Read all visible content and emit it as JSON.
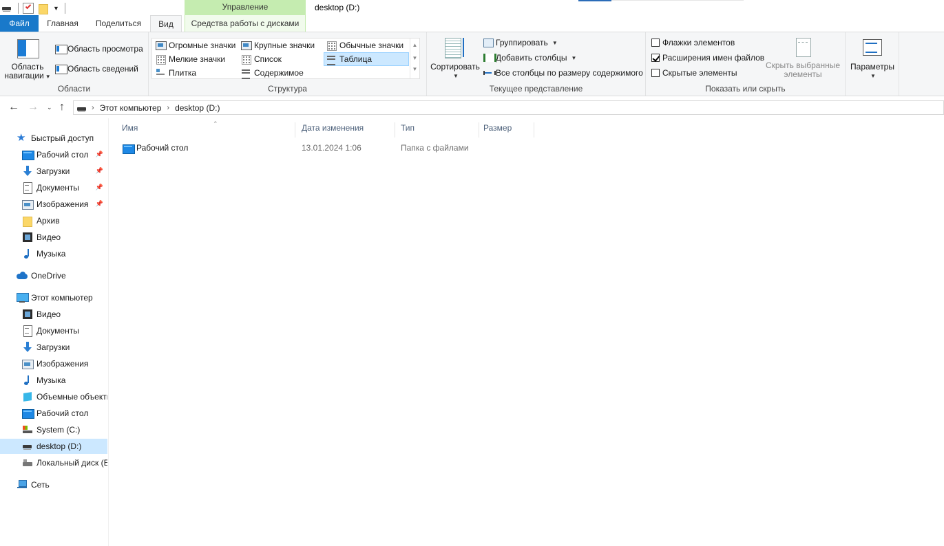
{
  "window": {
    "title": "desktop (D:)",
    "contextual_tab_header": "Управление"
  },
  "tabs": {
    "file": "Файл",
    "home": "Главная",
    "share": "Поделиться",
    "view": "Вид",
    "disk_tools": "Средства работы с дисками"
  },
  "ribbon": {
    "panes": {
      "label": "Области",
      "navigation_pane": "Область навигации",
      "preview_pane": "Область просмотра",
      "details_pane": "Область сведений"
    },
    "layout": {
      "label": "Структура",
      "options": [
        "Огромные значки",
        "Крупные значки",
        "Обычные значки",
        "Мелкие значки",
        "Список",
        "Таблица",
        "Плитка",
        "Содержимое"
      ],
      "selected": "Таблица"
    },
    "current_view": {
      "label": "Текущее представление",
      "sort_by": "Сортировать",
      "group_by": "Группировать",
      "add_columns": "Добавить столбцы",
      "fit_columns": "Все столбцы по размеру содержимого"
    },
    "show_hide": {
      "label": "Показать или скрыть",
      "item_checkboxes": {
        "label": "Флажки элементов",
        "checked": false
      },
      "file_extensions": {
        "label": "Расширения имен файлов",
        "checked": true
      },
      "hidden_items": {
        "label": "Скрытые элементы",
        "checked": false
      },
      "hide_selected": "Скрыть выбранные элементы"
    },
    "options": {
      "label": "Параметры"
    }
  },
  "address": {
    "crumbs": [
      "Этот компьютер",
      "desktop (D:)"
    ]
  },
  "nav": {
    "quick_access": "Быстрый доступ",
    "qa_items": [
      {
        "label": "Рабочий стол",
        "icon": "desktop-icon",
        "pinned": true
      },
      {
        "label": "Загрузки",
        "icon": "downloads-icon",
        "pinned": true
      },
      {
        "label": "Документы",
        "icon": "documents-icon",
        "pinned": true
      },
      {
        "label": "Изображения",
        "icon": "pictures-icon",
        "pinned": true
      },
      {
        "label": "Архив",
        "icon": "folder-icon",
        "pinned": false
      },
      {
        "label": "Видео",
        "icon": "video-icon",
        "pinned": false
      },
      {
        "label": "Музыка",
        "icon": "music-icon",
        "pinned": false
      }
    ],
    "onedrive": "OneDrive",
    "this_pc": "Этот компьютер",
    "pc_items": [
      {
        "label": "Видео",
        "icon": "video-icon"
      },
      {
        "label": "Документы",
        "icon": "documents-icon"
      },
      {
        "label": "Загрузки",
        "icon": "downloads-icon"
      },
      {
        "label": "Изображения",
        "icon": "pictures-icon"
      },
      {
        "label": "Музыка",
        "icon": "music-icon"
      },
      {
        "label": "Объемные объекты",
        "icon": "3d-objects-icon"
      },
      {
        "label": "Рабочий стол",
        "icon": "desktop-icon"
      },
      {
        "label": "System (C:)",
        "icon": "system-drive-icon"
      },
      {
        "label": "desktop (D:)",
        "icon": "drive-icon",
        "selected": true
      },
      {
        "label": "Локальный диск (E:)",
        "icon": "local-disk-icon"
      }
    ],
    "network": "Сеть"
  },
  "files": {
    "columns": [
      "Имя",
      "Дата изменения",
      "Тип",
      "Размер"
    ],
    "rows": [
      {
        "name": "Рабочий стол",
        "modified": "13.01.2024 1:06",
        "type": "Папка с файлами",
        "size": ""
      }
    ]
  },
  "colors": {
    "file_tab": "#1979ca",
    "disk_tools_accent": "#c5ecb0",
    "selection": "#cce8ff"
  }
}
